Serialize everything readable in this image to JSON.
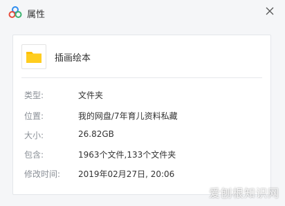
{
  "window": {
    "title": "属性",
    "logo_icon": "baidu-netdisk-logo",
    "close_icon": "close-icon"
  },
  "file": {
    "name": "插画绘本",
    "icon": "folder-icon"
  },
  "properties": [
    {
      "label": "类型:",
      "value": "文件夹"
    },
    {
      "label": "位置:",
      "value": "我的网盘/7年育儿资料私藏"
    },
    {
      "label": "大小:",
      "value": "26.82GB"
    },
    {
      "label": "包含:",
      "value": "1963个文件,133个文件夹"
    },
    {
      "label": "修改时间:",
      "value": "2019年02月27日, 20:06"
    }
  ],
  "watermark": "爱刨根知识网",
  "colors": {
    "background": "#f5f6f8",
    "panel": "#ffffff",
    "folder": "#ffc000",
    "label": "#8a8f96",
    "value": "#333333"
  }
}
